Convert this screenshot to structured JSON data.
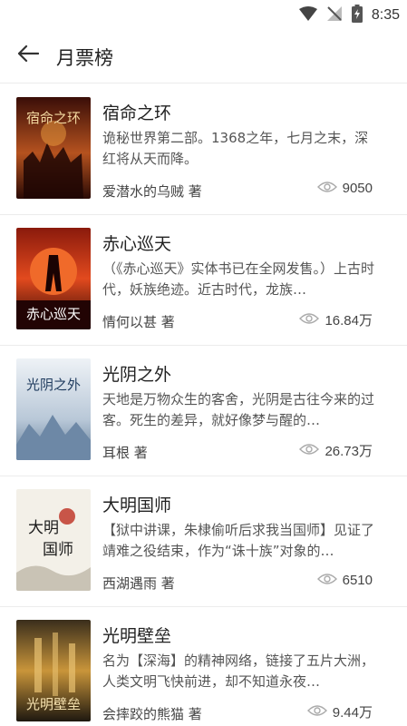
{
  "status_bar": {
    "time": "8:35"
  },
  "header": {
    "title": "月票榜"
  },
  "books": [
    {
      "title": "宿命之环",
      "desc": "诡秘世界第二部。1368之年，七月之末，深红将从天而降。",
      "author": "爱潜水的乌贼 著",
      "views": "9050",
      "cover_text": "宿命之环",
      "cover_colors": [
        "#5a1a10",
        "#c8602a"
      ]
    },
    {
      "title": "赤心巡天",
      "desc": "（《赤心巡天》实体书已在全网发售。）上古时代，妖族绝迹。近古时代，龙族…",
      "author": "情何以甚 著",
      "views": "16.84万",
      "cover_text": "赤心巡天",
      "cover_colors": [
        "#3a0a08",
        "#e0401c"
      ]
    },
    {
      "title": "光阴之外",
      "desc": "天地是万物众生的客舍，光阴是古往今来的过客。死生的差异，就好像梦与醒的…",
      "author": "耳根 著",
      "views": "26.73万",
      "cover_text": "光阴之外",
      "cover_colors": [
        "#dfe6ee",
        "#7f98b3"
      ]
    },
    {
      "title": "大明国师",
      "desc": "【狱中讲课，朱棣偷听后求我当国师】见证了靖难之役结束，作为“诛十族”对象的…",
      "author": "西湖遇雨 著",
      "views": "6510",
      "cover_text": "大明国师",
      "cover_colors": [
        "#f4f1ea",
        "#b8b2a5"
      ]
    },
    {
      "title": "光明壁垒",
      "desc": "名为【深海】的精神网络，链接了五片大洲，人类文明飞快前进，却不知道永夜…",
      "author": "会摔跤的熊猫 著",
      "views": "9.44万",
      "cover_text": "光明壁垒",
      "cover_colors": [
        "#2a2418",
        "#c89a3c"
      ]
    }
  ]
}
